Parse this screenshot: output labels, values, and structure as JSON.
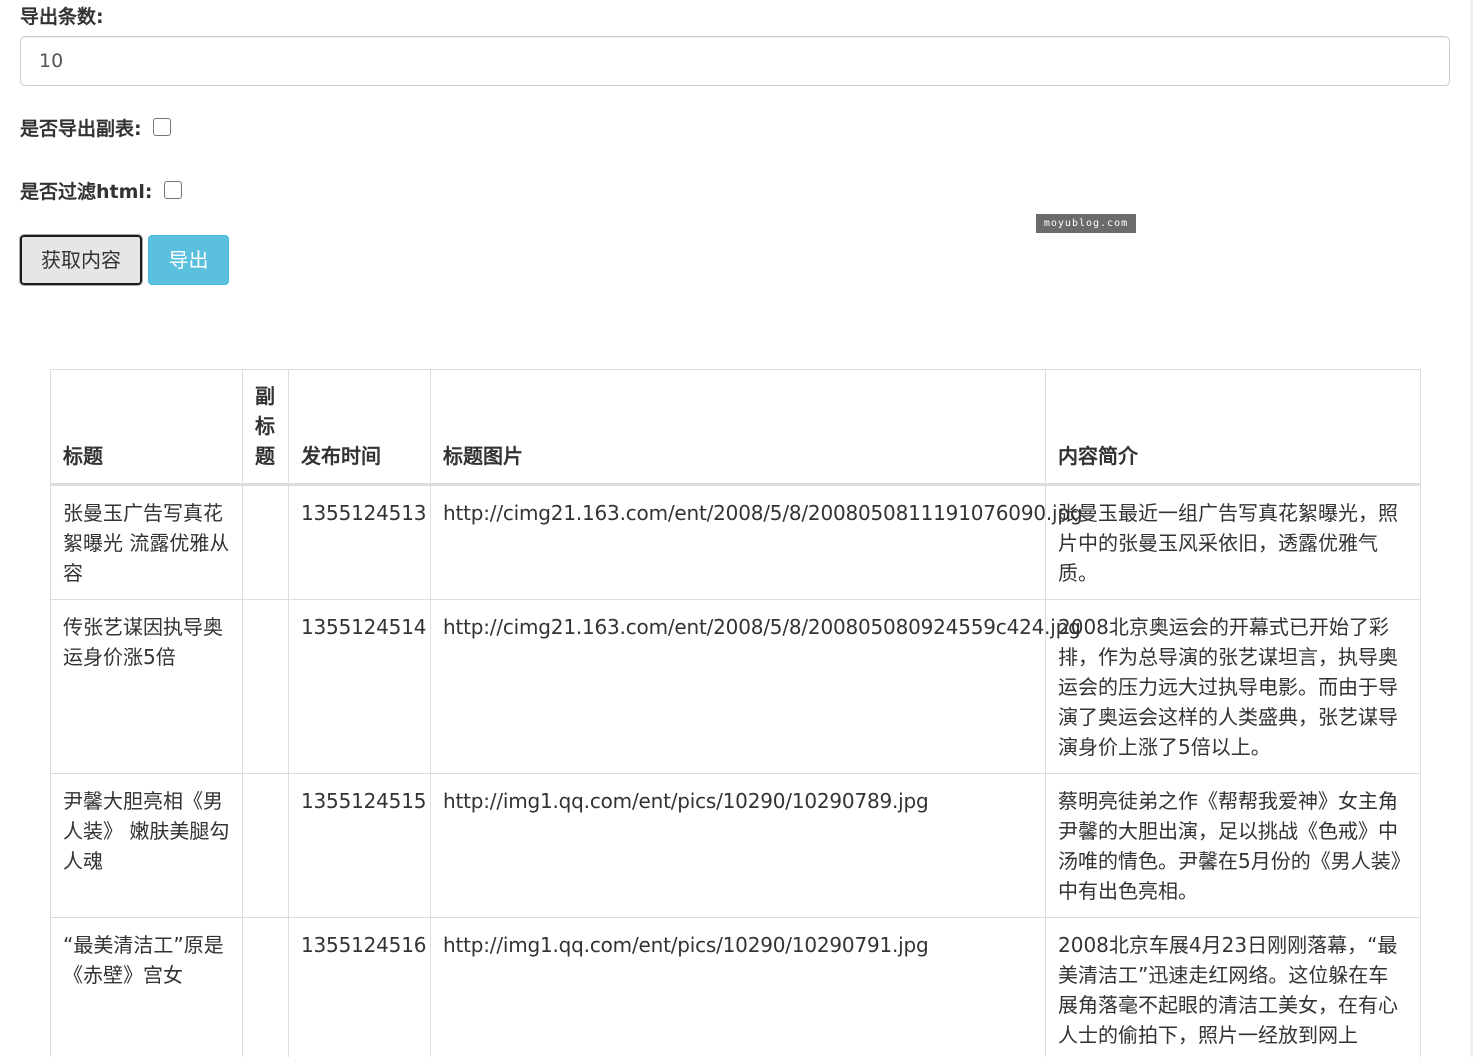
{
  "form": {
    "count_label": "导出条数:",
    "count_value": "10",
    "export_subtable_label": "是否导出副表:",
    "export_subtable_checked": false,
    "filter_html_label": "是否过滤html:",
    "filter_html_checked": false,
    "fetch_button": "获取内容",
    "export_button": "导出"
  },
  "watermark": "moyublog.com",
  "table": {
    "headers": [
      "标题",
      "副标题",
      "发布时间",
      "标题图片",
      "内容简介"
    ],
    "rows": [
      {
        "title": "张曼玉广告写真花絮曝光 流露优雅从容",
        "subtitle": "",
        "time": "1355124513",
        "image": "http://cimg21.163.com/ent/2008/5/8/2008050811191076090.jpg",
        "summary": "张曼玉最近一组广告写真花絮曝光，照片中的张曼玉风采依旧，透露优雅气质。"
      },
      {
        "title": "传张艺谋因执导奥运身价涨5倍",
        "subtitle": "",
        "time": "1355124514",
        "image": "http://cimg21.163.com/ent/2008/5/8/200805080924559c424.jpg",
        "summary": "2008北京奥运会的开幕式已开始了彩排，作为总导演的张艺谋坦言，执导奥运会的压力远大过执导电影。而由于导演了奥运会这样的人类盛典，张艺谋导演身价上涨了5倍以上。"
      },
      {
        "title": "尹馨大胆亮相《男人装》 嫩肤美腿勾人魂",
        "subtitle": "",
        "time": "1355124515",
        "image": "http://img1.qq.com/ent/pics/10290/10290789.jpg",
        "summary": "蔡明亮徒弟之作《帮帮我爱神》女主角尹馨的大胆出演，足以挑战《色戒》中汤唯的情色。尹馨在5月份的《男人装》中有出色亮相。"
      },
      {
        "title": "“最美清洁工”原是《赤壁》宫女",
        "subtitle": "",
        "time": "1355124516",
        "image": "http://img1.qq.com/ent/pics/10290/10290791.jpg",
        "summary": "2008北京车展4月23日刚刚落幕，“最美清洁工”迅速走红网络。这位躲在车展角落毫不起眼的清洁工美女，在有心人士的偷拍下，照片一经放到网上"
      }
    ]
  }
}
